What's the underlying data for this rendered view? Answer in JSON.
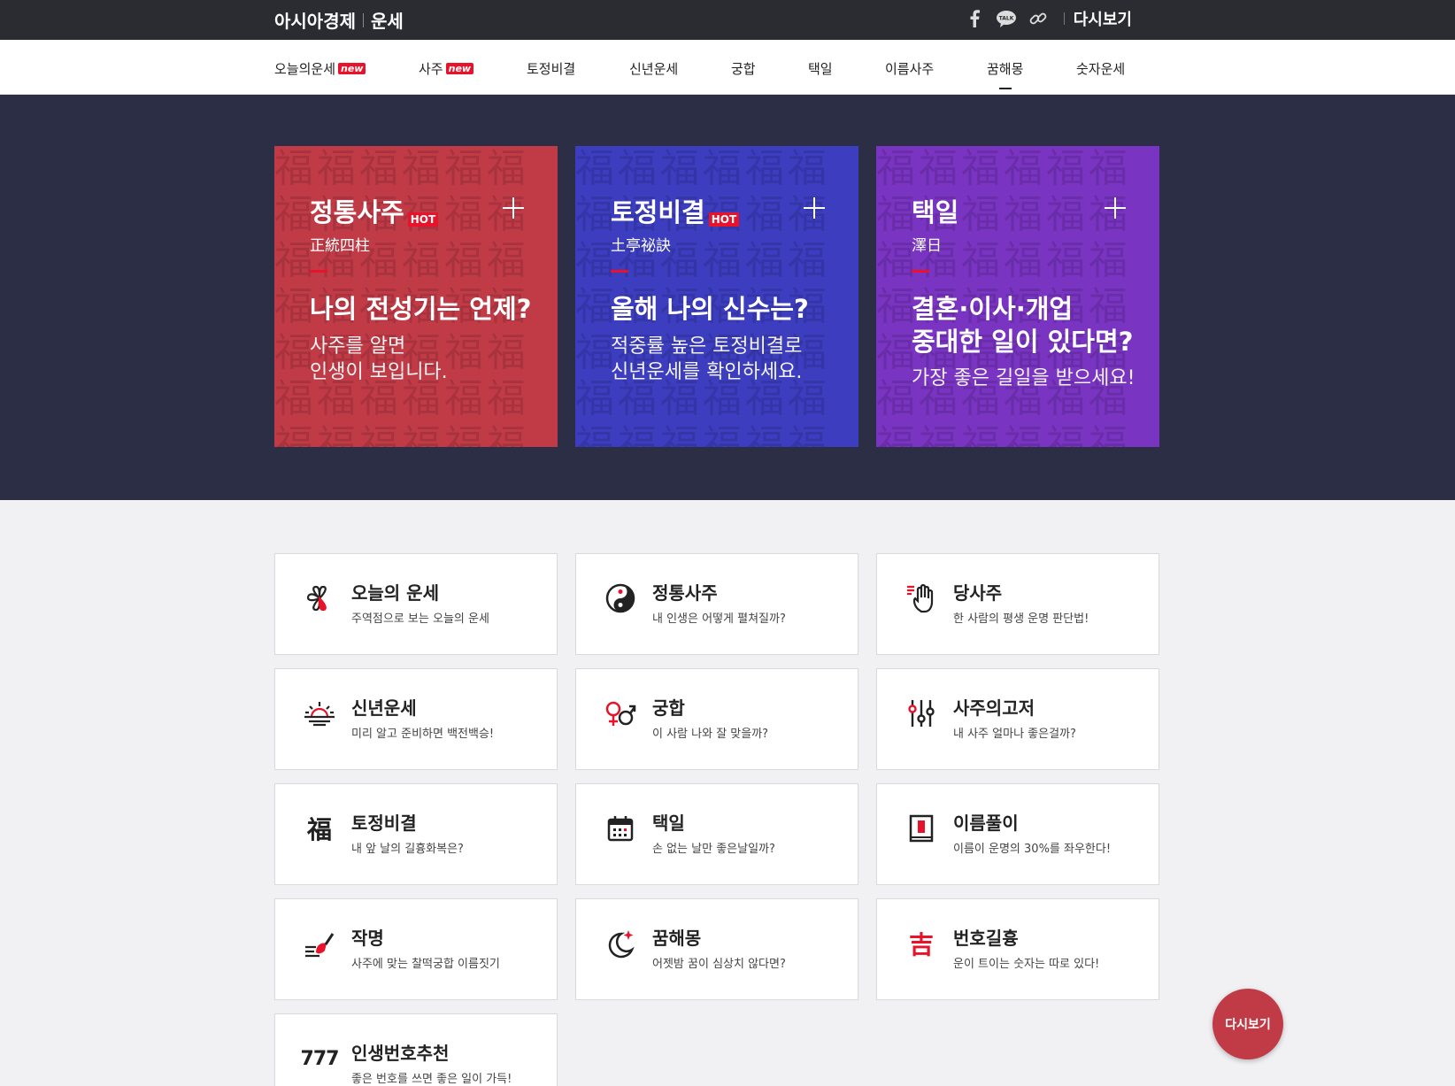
{
  "header": {
    "brand": "아시아경제",
    "section": "운세",
    "facebook_icon": "facebook-icon",
    "talk_icon": "kakaotalk-icon",
    "talk_label": "TALK",
    "link_icon": "link-icon",
    "again_label": "다시보기"
  },
  "nav": {
    "items": [
      {
        "label": "오늘의운세",
        "badge": "new"
      },
      {
        "label": "사주",
        "badge": "new"
      },
      {
        "label": "토정비결"
      },
      {
        "label": "신년운세"
      },
      {
        "label": "궁합"
      },
      {
        "label": "택일"
      },
      {
        "label": "이름사주"
      },
      {
        "label": "꿈해몽"
      },
      {
        "label": "숫자운세"
      }
    ],
    "active": "꿈해몽"
  },
  "hero": {
    "pattern_char": "福",
    "cards": [
      {
        "title": "정통사주",
        "badge": "HOT",
        "hanja": "正統四柱",
        "headline": "나의 전성기는 언제?",
        "desc_line1": "사주를 알면",
        "desc_line2": "인생이 보입니다.",
        "color": "#c13b47"
      },
      {
        "title": "토정비결",
        "badge": "HOT",
        "hanja": "土亭祕訣",
        "headline": "올해 나의 신수는?",
        "desc_line1": "적중률 높은 토정비결로",
        "desc_line2": "신년운세를 확인하세요.",
        "color": "#3c3dbf"
      },
      {
        "title": "택일",
        "hanja": "澤日",
        "headline_line1": "결혼·이사·개업",
        "headline_line2": "중대한 일이 있다면?",
        "desc_line1": "가장 좋은 길일을 받으세요!",
        "color": "#7a34c2"
      }
    ]
  },
  "services": [
    {
      "title": "오늘의 운세",
      "sub": "주역점으로 보는 오늘의 운세",
      "icon": "clover-icon"
    },
    {
      "title": "정통사주",
      "sub": "내 인생은 어떻게 펼쳐질까?",
      "icon": "yin-yang-icon"
    },
    {
      "title": "당사주",
      "sub": "한 사람의 평생 운명 판단법!",
      "icon": "hand-icon"
    },
    {
      "title": "신년운세",
      "sub": "미리 알고 준비하면 백전백승!",
      "icon": "sunrise-icon"
    },
    {
      "title": "궁합",
      "sub": "이 사람 나와 잘 맞을까?",
      "icon": "gender-icon"
    },
    {
      "title": "사주의고저",
      "sub": "내 사주 얼마나 좋은걸까?",
      "icon": "sliders-icon"
    },
    {
      "title": "토정비결",
      "sub": "내 앞 날의 길흉화복은?",
      "icon": "fortune-char-icon",
      "glyph": "福"
    },
    {
      "title": "택일",
      "sub": "손 없는 날만 좋은날일까?",
      "icon": "calendar-icon"
    },
    {
      "title": "이름풀이",
      "sub": "이름이 운명의 30%를 좌우한다!",
      "icon": "book-icon"
    },
    {
      "title": "작명",
      "sub": "사주에 맞는 찰떡궁합 이름짓기",
      "icon": "brush-icon"
    },
    {
      "title": "꿈해몽",
      "sub": "어젯밤 꿈이 심상치 않다면?",
      "icon": "moon-icon"
    },
    {
      "title": "번호길흉",
      "sub": "운이 트이는 숫자는 따로 있다!",
      "icon": "lucky-char-icon",
      "glyph": "吉"
    },
    {
      "title": "인생번호추천",
      "sub": "좋은 번호를 쓰면 좋은 일이 가득!",
      "icon": "number-777-icon",
      "glyph": "777"
    }
  ],
  "float_button": "다시보기",
  "colors": {
    "accent": "#e8132b",
    "topbar": "#2b2c31",
    "hero_bg": "#2b2e45"
  }
}
